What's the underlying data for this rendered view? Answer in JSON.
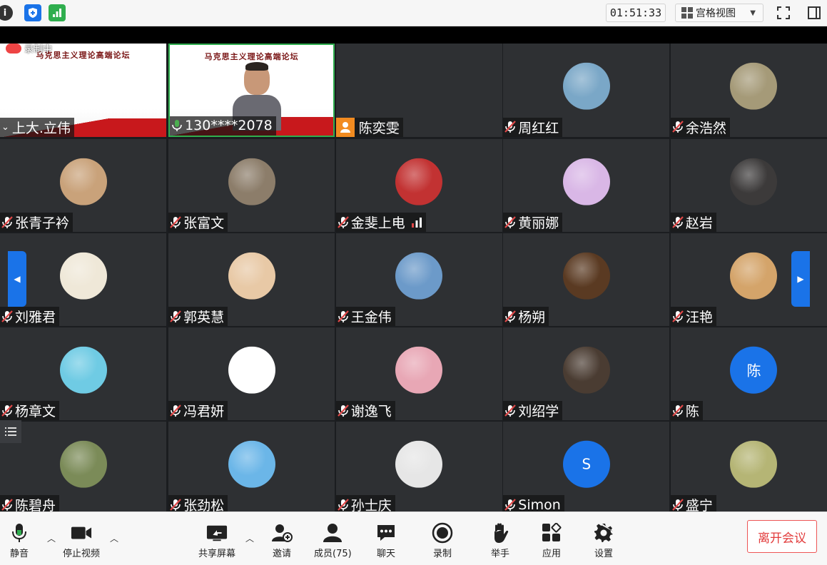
{
  "topbar": {
    "timer": "01:51:33",
    "view_label": "宫格视图"
  },
  "recording_label": "录制中",
  "banner_title": "马克思主义理论高端论坛",
  "tiles": [
    {
      "name": "上大.立伟",
      "type": "video1"
    },
    {
      "name": "130****2078",
      "type": "video2"
    },
    {
      "name": "陈奕雯",
      "type": "orange"
    },
    {
      "name": "周红红",
      "type": "avatar",
      "color": "#7aa7c7"
    },
    {
      "name": "余浩然",
      "type": "avatar",
      "color": "#a59a78"
    },
    {
      "name": "张青子衿",
      "type": "avatar",
      "color": "#c9a27a"
    },
    {
      "name": "张富文",
      "type": "avatar",
      "color": "#8c7d6a"
    },
    {
      "name": "金斐上电",
      "type": "avatar",
      "color": "#c23232",
      "signal": true
    },
    {
      "name": "黄丽娜",
      "type": "avatar",
      "color": "#d9b7e6"
    },
    {
      "name": "赵岩",
      "type": "avatar",
      "color": "#3c3a3a"
    },
    {
      "name": "刘雅君",
      "type": "avatar",
      "color": "#efe8d8"
    },
    {
      "name": "郭英慧",
      "type": "avatar",
      "color": "#e8c9a6"
    },
    {
      "name": "王金伟",
      "type": "avatar",
      "color": "#6c9ac9"
    },
    {
      "name": "杨朔",
      "type": "avatar",
      "color": "#5a3a22"
    },
    {
      "name": "汪艳",
      "type": "avatar",
      "color": "#d4a46a"
    },
    {
      "name": "杨章文",
      "type": "avatar",
      "color": "#6fcbe4"
    },
    {
      "name": "冯君妍",
      "type": "avatar",
      "color": "#ffffff"
    },
    {
      "name": "谢逸飞",
      "type": "avatar",
      "color": "#e8a7b5"
    },
    {
      "name": "刘绍学",
      "type": "avatar",
      "color": "#4a3c32"
    },
    {
      "name": "陈",
      "type": "letter",
      "letter": "陈",
      "color": "#1a73e8"
    },
    {
      "name": "陈碧舟",
      "type": "avatar",
      "color": "#7b8b58"
    },
    {
      "name": "张劲松",
      "type": "avatar",
      "color": "#6bb6e8"
    },
    {
      "name": "孙士庆",
      "type": "avatar",
      "color": "#e6e6e6"
    },
    {
      "name": "Simon",
      "type": "letter",
      "letter": "S",
      "color": "#1a73e8"
    },
    {
      "name": "盛宁",
      "type": "avatar",
      "color": "#b5b575"
    }
  ],
  "toolbar": {
    "mute": "静音",
    "stop_video": "停止视频",
    "share": "共享屏幕",
    "invite": "邀请",
    "members": "成员(75)",
    "chat": "聊天",
    "record": "录制",
    "raise_hand": "举手",
    "apps": "应用",
    "settings": "设置",
    "leave": "离开会议"
  },
  "colors": {
    "accent": "#1a73e8",
    "leave": "#e23b3b",
    "mic_active": "#4caf50",
    "mic_off": "#e04848"
  }
}
